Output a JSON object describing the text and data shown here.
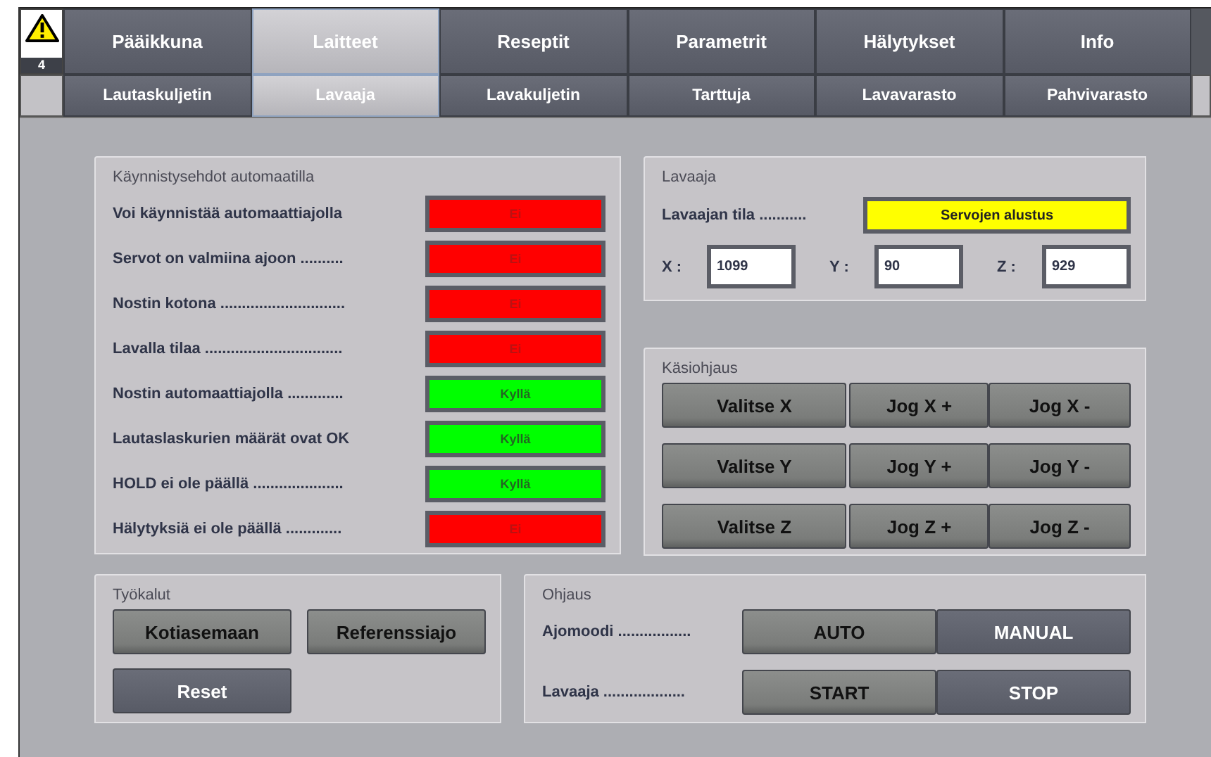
{
  "alarm": {
    "count": "4"
  },
  "tabs": [
    {
      "label": "Pääikkuna",
      "selected": false
    },
    {
      "label": "Laitteet",
      "selected": true
    },
    {
      "label": "Reseptit",
      "selected": false
    },
    {
      "label": "Parametrit",
      "selected": false
    },
    {
      "label": "Hälytykset",
      "selected": false
    },
    {
      "label": "Info",
      "selected": false
    }
  ],
  "subtabs": [
    {
      "label": "Lautaskuljetin",
      "selected": false
    },
    {
      "label": "Lavaaja",
      "selected": true
    },
    {
      "label": "Lavakuljetin",
      "selected": false
    },
    {
      "label": "Tarttuja",
      "selected": false
    },
    {
      "label": "Lavavarasto",
      "selected": false
    },
    {
      "label": "Pahvivarasto",
      "selected": false
    }
  ],
  "start_conditions": {
    "title": "Käynnistysehdot automaatilla",
    "rows": [
      {
        "label": "Voi käynnistää automaattiajolla",
        "value": "Ei",
        "color": "#ff0000"
      },
      {
        "label": "Servot on valmiina ajoon ..........",
        "value": "Ei",
        "color": "#ff0000"
      },
      {
        "label": "Nostin kotona .............................",
        "value": "Ei",
        "color": "#ff0000"
      },
      {
        "label": "Lavalla tilaa ................................",
        "value": "Ei",
        "color": "#ff0000"
      },
      {
        "label": "Nostin automaattiajolla .............",
        "value": "Kyllä",
        "color": "#00ff00"
      },
      {
        "label": "Lautaslaskurien määrät ovat OK",
        "value": "Kyllä",
        "color": "#00ff00"
      },
      {
        "label": "HOLD ei ole päällä .....................",
        "value": "Kyllä",
        "color": "#00ff00"
      },
      {
        "label": "Hälytyksiä ei ole päällä .............",
        "value": "Ei",
        "color": "#ff0000"
      }
    ]
  },
  "stacker": {
    "title": "Lavaaja",
    "state_label": "Lavaajan tila ...........",
    "state": {
      "value": "Servojen alustus",
      "color": "#ffff00"
    },
    "axes": [
      {
        "label": "X :",
        "value": "1099"
      },
      {
        "label": "Y :",
        "value": "90"
      },
      {
        "label": "Z :",
        "value": "929"
      }
    ]
  },
  "manual_control": {
    "title": "Käsiohjaus",
    "rows": [
      {
        "select": "Valitse X",
        "plus": "Jog X +",
        "minus": "Jog X -"
      },
      {
        "select": "Valitse Y",
        "plus": "Jog Y +",
        "minus": "Jog Y -"
      },
      {
        "select": "Valitse Z",
        "plus": "Jog Z +",
        "minus": "Jog Z -"
      }
    ]
  },
  "tools": {
    "title": "Työkalut",
    "buttons": [
      {
        "label": "Kotiasemaan",
        "kind": "light"
      },
      {
        "label": "Referenssiajo",
        "kind": "light"
      },
      {
        "label": "Reset",
        "kind": "dark"
      }
    ]
  },
  "control": {
    "title": "Ohjaus",
    "rows": [
      {
        "label": "Ajomoodi .................",
        "buttons": [
          {
            "label": "AUTO",
            "kind": "light"
          },
          {
            "label": "MANUAL",
            "kind": "dark"
          }
        ]
      },
      {
        "label": "Lavaaja ...................",
        "buttons": [
          {
            "label": "START",
            "kind": "light"
          },
          {
            "label": "STOP",
            "kind": "dark"
          }
        ]
      }
    ]
  }
}
